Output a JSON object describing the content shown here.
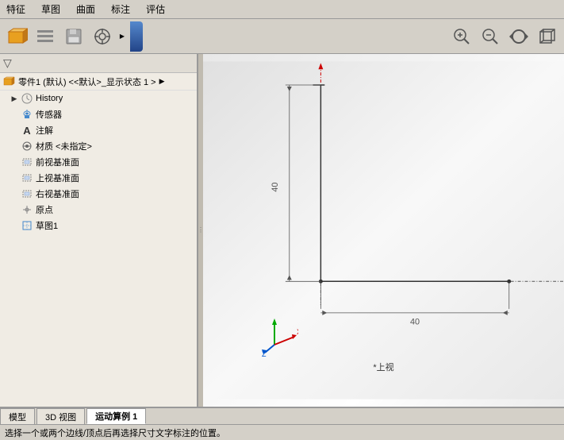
{
  "menu": {
    "items": [
      "特征",
      "草图",
      "曲面",
      "标注",
      "评估"
    ]
  },
  "toolbar": {
    "buttons": [
      {
        "name": "part-icon",
        "symbol": "📦"
      },
      {
        "name": "feature-manager",
        "symbol": "≡"
      },
      {
        "name": "save",
        "symbol": "💾"
      },
      {
        "name": "target",
        "symbol": "⊕"
      }
    ],
    "right_buttons": [
      {
        "name": "zoom-fit",
        "symbol": "🔍"
      },
      {
        "name": "zoom-in",
        "symbol": "🔎"
      },
      {
        "name": "rotate",
        "symbol": "↻"
      },
      {
        "name": "view-3d",
        "symbol": "⬜"
      }
    ]
  },
  "left_panel": {
    "part_label": "零件1 (默认) <<默认>_显示状态 1 >",
    "tree_items": [
      {
        "id": "history",
        "indent": 1,
        "has_expand": true,
        "icon": "🕐",
        "label": "History"
      },
      {
        "id": "sensor",
        "indent": 1,
        "has_expand": false,
        "icon": "📡",
        "label": "传感器"
      },
      {
        "id": "annotation",
        "indent": 1,
        "has_expand": false,
        "icon": "A",
        "label": "注解"
      },
      {
        "id": "material",
        "indent": 1,
        "has_expand": false,
        "icon": "◈",
        "label": "材质 <未指定>"
      },
      {
        "id": "front-plane",
        "indent": 1,
        "has_expand": false,
        "icon": "▣",
        "label": "前视基准面"
      },
      {
        "id": "top-plane",
        "indent": 1,
        "has_expand": false,
        "icon": "▣",
        "label": "上视基准面"
      },
      {
        "id": "right-plane",
        "indent": 1,
        "has_expand": false,
        "icon": "▣",
        "label": "右视基准面"
      },
      {
        "id": "origin",
        "indent": 1,
        "has_expand": false,
        "icon": "⊕",
        "label": "原点"
      },
      {
        "id": "sketch1",
        "indent": 1,
        "has_expand": false,
        "icon": "📐",
        "label": "草图1"
      }
    ]
  },
  "drawing": {
    "dim1_label": "40",
    "dim2_label": "40"
  },
  "view_label": "*上视",
  "bottom_tabs": [
    {
      "id": "model",
      "label": "模型",
      "active": false
    },
    {
      "id": "3d-view",
      "label": "3D 视图",
      "active": false
    },
    {
      "id": "motion-example",
      "label": "运动算例 1",
      "active": true
    }
  ],
  "status_bar": {
    "text": "选择一个或两个边线/顶点后再选择尺寸文字标注的位置。"
  }
}
